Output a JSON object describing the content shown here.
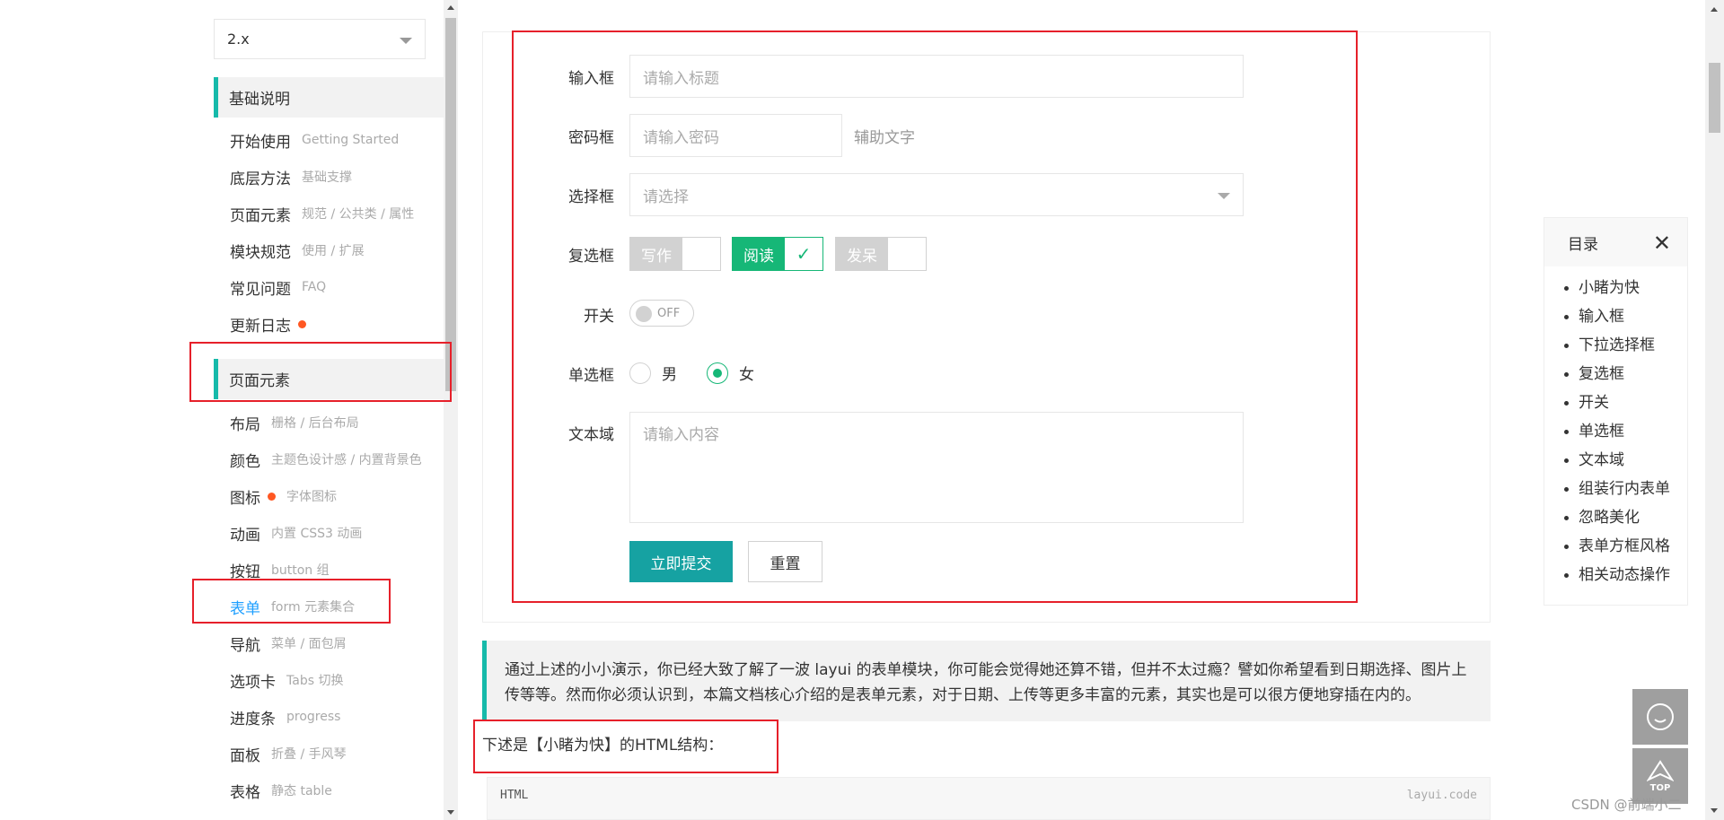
{
  "sidebar": {
    "version": "2.x",
    "basics": {
      "title": "基础说明",
      "items": [
        {
          "label": "开始使用",
          "sub": "Getting Started"
        },
        {
          "label": "底层方法",
          "sub": "基础支撑"
        },
        {
          "label": "页面元素",
          "sub": "规范 / 公共类 / 属性"
        },
        {
          "label": "模块规范",
          "sub": "使用 / 扩展"
        },
        {
          "label": "常见问题",
          "sub": "FAQ"
        },
        {
          "label": "更新日志",
          "sub": ""
        }
      ]
    },
    "elements": {
      "title": "页面元素",
      "items": [
        {
          "label": "布局",
          "sub": "栅格 / 后台布局"
        },
        {
          "label": "颜色",
          "sub": "主题色设计感 / 内置背景色"
        },
        {
          "label": "图标",
          "sub": "字体图标"
        },
        {
          "label": "动画",
          "sub": "内置 CSS3 动画"
        },
        {
          "label": "按钮",
          "sub": "button 组"
        },
        {
          "label": "表单",
          "sub": "form 元素集合"
        },
        {
          "label": "导航",
          "sub": "菜单 / 面包屑"
        },
        {
          "label": "选项卡",
          "sub": "Tabs 切换"
        },
        {
          "label": "进度条",
          "sub": "progress"
        },
        {
          "label": "面板",
          "sub": "折叠 / 手风琴"
        },
        {
          "label": "表格",
          "sub": "静态 table"
        }
      ]
    }
  },
  "form": {
    "input_label": "输入框",
    "input_placeholder": "请输入标题",
    "password_label": "密码框",
    "password_placeholder": "请输入密码",
    "password_aux": "辅助文字",
    "select_label": "选择框",
    "select_placeholder": "请选择",
    "checkbox_label": "复选框",
    "checkboxes": [
      {
        "label": "写作",
        "checked": false
      },
      {
        "label": "阅读",
        "checked": true
      },
      {
        "label": "发呆",
        "checked": false
      }
    ],
    "switch_label": "开关",
    "switch_state": "OFF",
    "radio_label": "单选框",
    "radios": [
      {
        "label": "男",
        "checked": false
      },
      {
        "label": "女",
        "checked": true
      }
    ],
    "textarea_label": "文本域",
    "textarea_placeholder": "请输入内容",
    "submit": "立即提交",
    "reset": "重置"
  },
  "quote": "通过上述的小小演示，你已经大致了解了一波 layui 的表单模块，你可能会觉得她还算不错，但并不太过瘾？譬如你希望看到日期选择、图片上传等等。然而你必须认识到，本篇文档核心介绍的是表单元素，对于日期、上传等更多丰富的元素，其实也是可以很方便地穿插在内的。",
  "html_heading": "下述是【小睹为快】的HTML结构：",
  "code": {
    "lang": "HTML",
    "brand": "layui.code"
  },
  "toc": {
    "title": "目录",
    "items": [
      "小睹为快",
      "输入框",
      "下拉选择框",
      "复选框",
      "开关",
      "单选框",
      "文本域",
      "组装行内表单",
      "忽略美化",
      "表单方框风格",
      "相关动态操作"
    ]
  },
  "fixbar": {
    "top_label": "TOP"
  },
  "watermark": "CSDN @前端小二",
  "colors": {
    "accent": "#16baaa",
    "checked": "#16b777",
    "primary_btn": "#16a2a2",
    "active_link": "#1e9fff",
    "highlight_box": "#e6202a"
  }
}
